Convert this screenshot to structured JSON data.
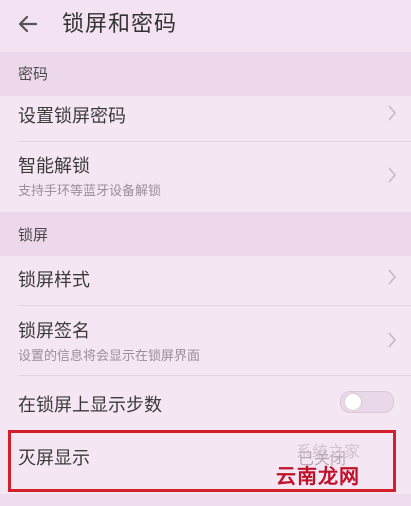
{
  "header": {
    "title": "锁屏和密码",
    "back_icon": "back-arrow-icon"
  },
  "sections": {
    "password": {
      "label": "密码"
    },
    "lockscreen": {
      "label": "锁屏"
    }
  },
  "rows": {
    "set_password": {
      "label": "设置锁屏密码"
    },
    "smart_unlock": {
      "label": "智能解锁",
      "sub": "支持手环等蓝牙设备解锁"
    },
    "lock_style": {
      "label": "锁屏样式"
    },
    "lock_signature": {
      "label": "锁屏签名",
      "sub": "设置的信息将会显示在锁屏界面"
    },
    "show_steps": {
      "label": "在锁屏上显示步数",
      "toggle_on": false
    },
    "screen_off_display": {
      "label": "灭屏显示",
      "status": "已关闭"
    }
  },
  "watermark": {
    "brand": "云南龙网",
    "faint": "系统之家"
  },
  "colors": {
    "background": "#f5e6f3",
    "highlight": "#d3202a",
    "watermark": "#c0112a"
  }
}
